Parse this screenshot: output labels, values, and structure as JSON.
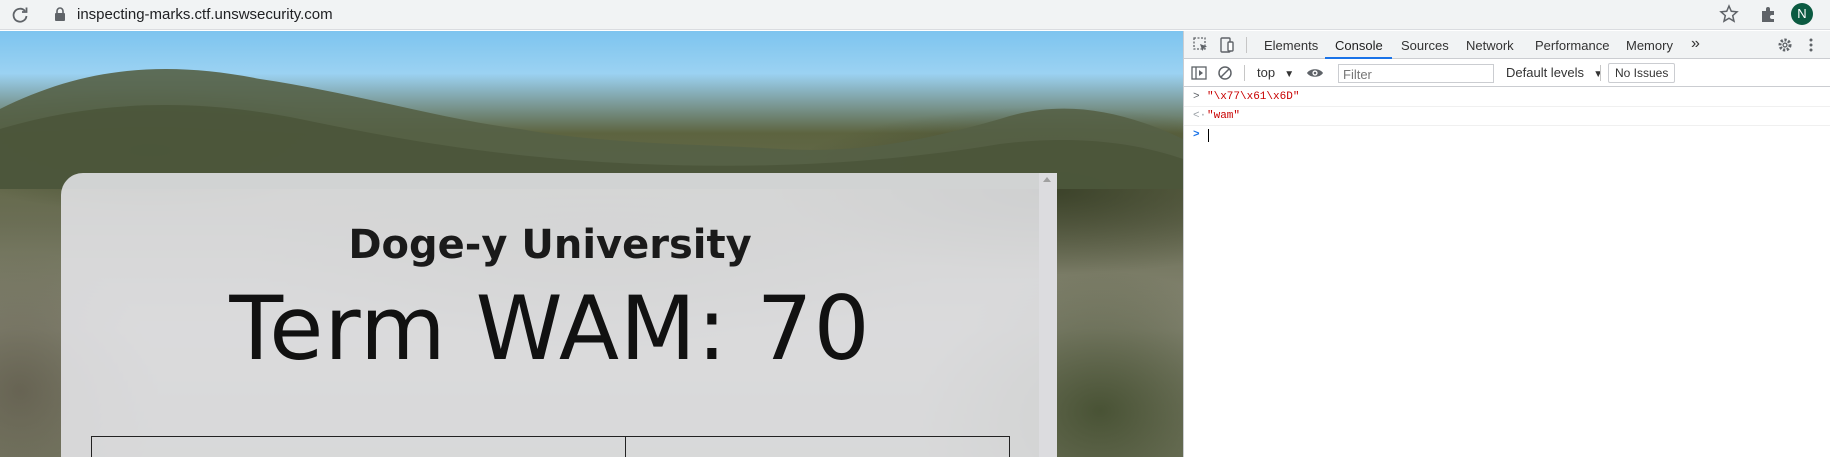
{
  "browser": {
    "url": "inspecting-marks.ctf.unswsecurity.com",
    "profile_initial": "N",
    "profile_color": "#0b5a41",
    "icons": [
      "reload-icon",
      "lock-icon",
      "star-icon",
      "puzzle-icon"
    ]
  },
  "page": {
    "university_name": "Doge-y University",
    "wam_text": "Term WAM: 70"
  },
  "devtools": {
    "tabs": [
      {
        "label": "Elements",
        "active": false
      },
      {
        "label": "Console",
        "active": true
      },
      {
        "label": "Sources",
        "active": false
      },
      {
        "label": "Network",
        "active": false
      },
      {
        "label": "Performance",
        "active": false
      },
      {
        "label": "Memory",
        "active": false
      }
    ],
    "more_tabs_glyph": "»",
    "toolbar": {
      "context": "top",
      "filter_placeholder": "Filter",
      "levels": "Default levels",
      "issues": "No Issues"
    },
    "console": [
      {
        "type": "input",
        "text": "\"\\x77\\x61\\x6D\""
      },
      {
        "type": "output",
        "text": "\"wam\""
      },
      {
        "type": "prompt",
        "text": ""
      }
    ],
    "accent_color": "#1a73e8"
  }
}
